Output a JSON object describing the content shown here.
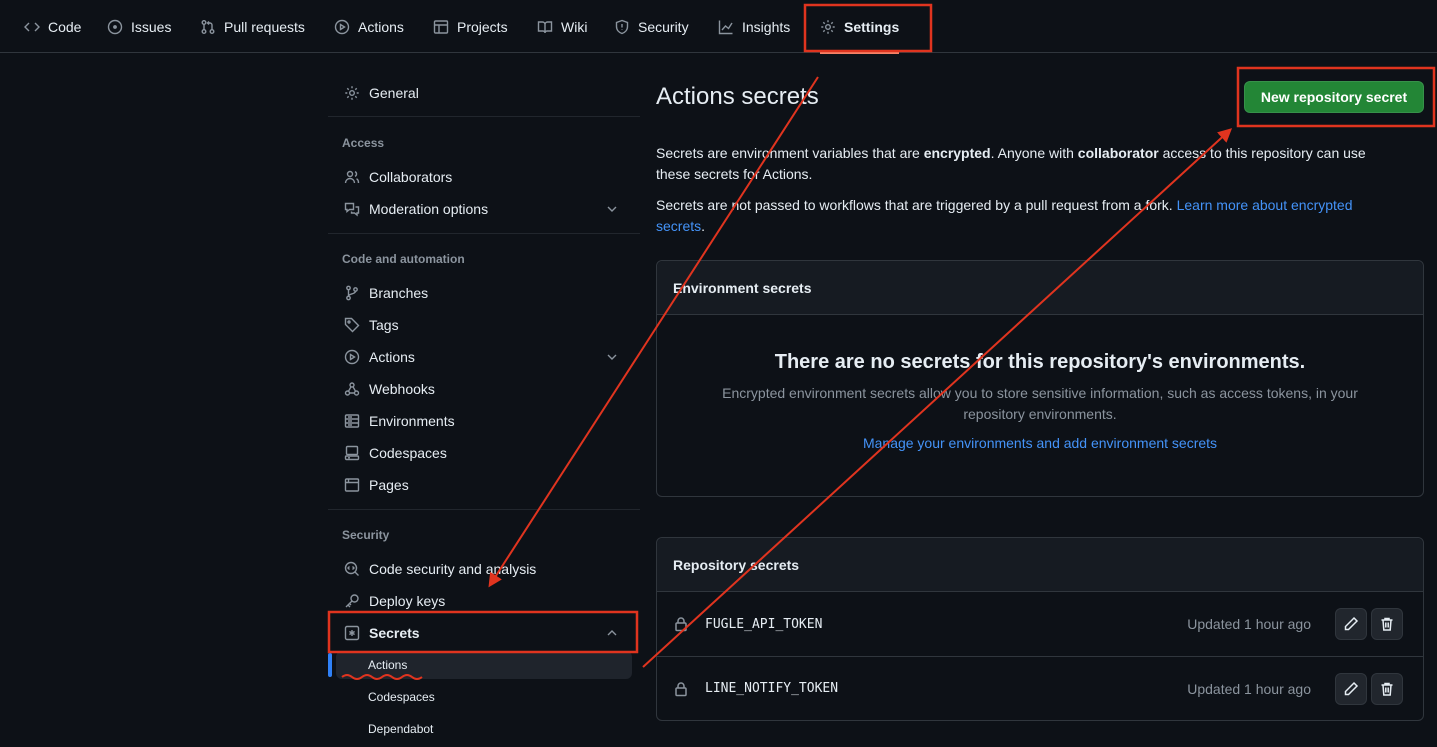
{
  "repo_nav": {
    "tabs": [
      {
        "label": "Code",
        "icon": "code-icon"
      },
      {
        "label": "Issues",
        "icon": "issue-opened-icon"
      },
      {
        "label": "Pull requests",
        "icon": "git-pull-request-icon"
      },
      {
        "label": "Actions",
        "icon": "play-icon"
      },
      {
        "label": "Projects",
        "icon": "table-icon"
      },
      {
        "label": "Wiki",
        "icon": "book-icon"
      },
      {
        "label": "Security",
        "icon": "shield-icon"
      },
      {
        "label": "Insights",
        "icon": "graph-icon"
      },
      {
        "label": "Settings",
        "icon": "gear-icon",
        "active": true
      }
    ]
  },
  "sidebar": {
    "general": "General",
    "access_heading": "Access",
    "access_items": [
      "Collaborators",
      "Moderation options"
    ],
    "code_heading": "Code and automation",
    "code_items": [
      "Branches",
      "Tags",
      "Actions",
      "Webhooks",
      "Environments",
      "Codespaces",
      "Pages"
    ],
    "security_heading": "Security",
    "security_items": [
      "Code security and analysis",
      "Deploy keys",
      "Secrets"
    ],
    "secrets_sub_items": [
      "Actions",
      "Codespaces",
      "Dependabot"
    ]
  },
  "main": {
    "title": "Actions secrets",
    "new_secret_button": "New repository secret",
    "intro": {
      "part1": "Secrets are environment variables that are ",
      "bold1": "encrypted",
      "part2": ". Anyone with ",
      "bold2": "collaborator",
      "part3": " access to this repository can use these secrets for Actions."
    },
    "note": {
      "text": "Secrets are not passed to workflows that are triggered by a pull request from a fork. ",
      "link": "Learn more about encrypted secrets",
      "end": "."
    },
    "environment_secrets": {
      "heading": "Environment secrets",
      "empty_title": "There are no secrets for this repository's environments.",
      "empty_text": "Encrypted environment secrets allow you to store sensitive information, such as access tokens, in your repository environments.",
      "manage_link": "Manage your environments and add environment secrets"
    },
    "repository_secrets": {
      "heading": "Repository secrets",
      "rows": [
        {
          "name": "FUGLE_API_TOKEN",
          "updated": "Updated 1 hour ago"
        },
        {
          "name": "LINE_NOTIFY_TOKEN",
          "updated": "Updated 1 hour ago"
        }
      ]
    }
  },
  "colors": {
    "background": "#0d1117",
    "primary_button": "#238636",
    "link": "#4493f8",
    "annotation": "#e0341f"
  }
}
